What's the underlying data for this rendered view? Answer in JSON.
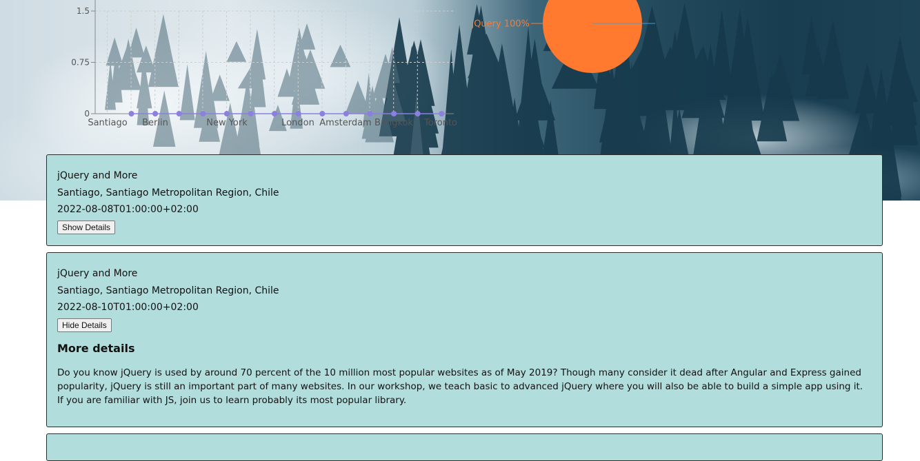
{
  "chart_data": [
    {
      "type": "line",
      "title": "",
      "xlabel": "",
      "ylabel": "",
      "x_tick_labels": [
        "Santiago",
        "Berlin",
        "New York",
        "London",
        "Amsterdam",
        "Bangkok",
        "Toronto"
      ],
      "y_tick_labels": [
        "0",
        "0.75",
        "1.5"
      ],
      "ylim": [
        0,
        1.5
      ],
      "grid": true,
      "point_count": 14,
      "values": [
        0,
        0,
        0,
        0,
        0,
        0,
        0,
        0,
        0,
        0,
        0,
        0,
        0,
        0
      ],
      "point_color": "#8b7fe0"
    },
    {
      "type": "pie",
      "slices": [
        {
          "label": "jQuery",
          "value": 100,
          "label_text": "jQuery 100%"
        }
      ],
      "color": "#ff7a2e"
    }
  ],
  "events": [
    {
      "title": "jQuery and More",
      "location": "Santiago, Santiago Metropolitan Region, Chile",
      "datetime": "2022-08-08T01:00:00+02:00",
      "button_label": "Show Details",
      "expanded": false
    },
    {
      "title": "jQuery and More",
      "location": "Santiago, Santiago Metropolitan Region, Chile",
      "datetime": "2022-08-10T01:00:00+02:00",
      "button_label": "Hide Details",
      "expanded": true,
      "details_heading": "More details",
      "details_text": "Do you know jQuery is used by around 70 percent of the 10 million most popular websites as of May 2019? Though many consider it dead after Angular and Express gained popularity, jQuery is still an important part of many websites. In our workshop, we teach basic to advanced jQuery where you will also be able to build a simple app using it. If you are familiar with JS, join us to learn probably its most popular library."
    }
  ]
}
